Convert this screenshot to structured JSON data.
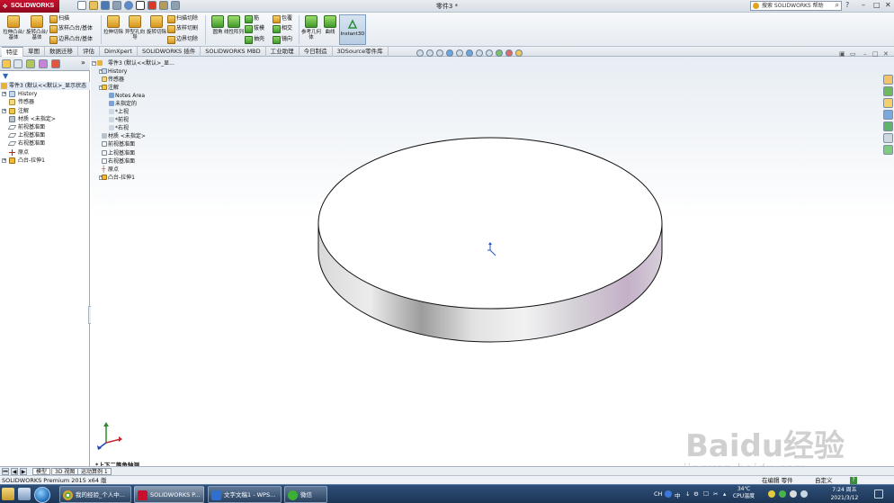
{
  "app": {
    "logo": "SOLIDWORKS",
    "window_title": "零件3 *",
    "search_placeholder": "搜索 SOLIDWORKS 帮助"
  },
  "command_manager": {
    "big_buttons": [
      {
        "label": "拉伸凸台/基体",
        "icon": "extrude-boss-icon"
      },
      {
        "label": "旋转凸台/基体",
        "icon": "revolve-boss-icon"
      },
      {
        "label": "拉伸切除",
        "icon": "extrude-cut-icon"
      },
      {
        "label": "异型孔向导",
        "icon": "hole-wizard-icon"
      },
      {
        "label": "旋转切除",
        "icon": "revolve-cut-icon"
      },
      {
        "label": "圆角",
        "icon": "fillet-icon"
      },
      {
        "label": "线性阵列",
        "icon": "linear-pattern-icon"
      },
      {
        "label": "参考几何体",
        "icon": "reference-geometry-icon"
      },
      {
        "label": "曲线",
        "icon": "curves-icon"
      },
      {
        "label": "Instant3D",
        "icon": "instant3d-icon"
      }
    ],
    "small_buttons": [
      {
        "label": "扫描"
      },
      {
        "label": "放样凸台/基体"
      },
      {
        "label": "边界凸台/基体"
      },
      {
        "label": "扫描切除"
      },
      {
        "label": "放样切割"
      },
      {
        "label": "边界切除"
      },
      {
        "label": "筋"
      },
      {
        "label": "拔模"
      },
      {
        "label": "抽壳"
      },
      {
        "label": "包覆"
      },
      {
        "label": "相交"
      },
      {
        "label": "镜向"
      }
    ]
  },
  "tabs": [
    "特征",
    "草图",
    "数据迁移",
    "评估",
    "DimXpert",
    "SOLIDWORKS 插件",
    "SOLIDWORKS MBD",
    "工业助理",
    "今日制造",
    "3DSource零件库"
  ],
  "left_tree": [
    {
      "label": "零件3 (默认<<默认>_显示状态"
    },
    {
      "label": "History"
    },
    {
      "label": "传感器"
    },
    {
      "label": "注解"
    },
    {
      "label": "材质 <未指定>"
    },
    {
      "label": "前视基准面"
    },
    {
      "label": "上视基准面"
    },
    {
      "label": "右视基准面"
    },
    {
      "label": "原点"
    },
    {
      "label": "凸台-拉伸1"
    }
  ],
  "flyout_tree": [
    {
      "label": "零件3 (默认<<默认>_显..."
    },
    {
      "label": "History"
    },
    {
      "label": "传感器"
    },
    {
      "label": "注解"
    },
    {
      "label": "Notes Area"
    },
    {
      "label": "未指定的"
    },
    {
      "label": "*上视"
    },
    {
      "label": "*前视"
    },
    {
      "label": "*右视"
    },
    {
      "label": "材质 <未指定>"
    },
    {
      "label": "前视基准面"
    },
    {
      "label": "上视基准面"
    },
    {
      "label": "右视基准面"
    },
    {
      "label": "原点"
    },
    {
      "label": "凸台-拉伸1"
    }
  ],
  "viewport": {
    "view_name": "*上下二等角轴测"
  },
  "bottom_tabs": [
    "模型",
    "3D 视图",
    "运动算例 1"
  ],
  "status": {
    "left": "SOLIDWORKS Premium 2015 x64 版",
    "editing": "在编辑 零件",
    "units": "自定义"
  },
  "taskbar": {
    "apps": [
      {
        "label": "我的经验_个人中...",
        "icon": "chrome-icon"
      },
      {
        "label": "SOLIDWORKS P...",
        "icon": "solidworks-icon"
      },
      {
        "label": "文字文稿1 - WPS...",
        "icon": "wps-icon"
      },
      {
        "label": "微信",
        "icon": "wechat-icon"
      }
    ],
    "ime": "CH",
    "ime_mode": "中",
    "temperature": "34℃",
    "cpu_label": "CPU温度",
    "time": "7:24 周五",
    "date": "2021/3/12"
  },
  "watermark": {
    "brand": "Baidu经验",
    "url": "jingyan.baidu.com"
  }
}
